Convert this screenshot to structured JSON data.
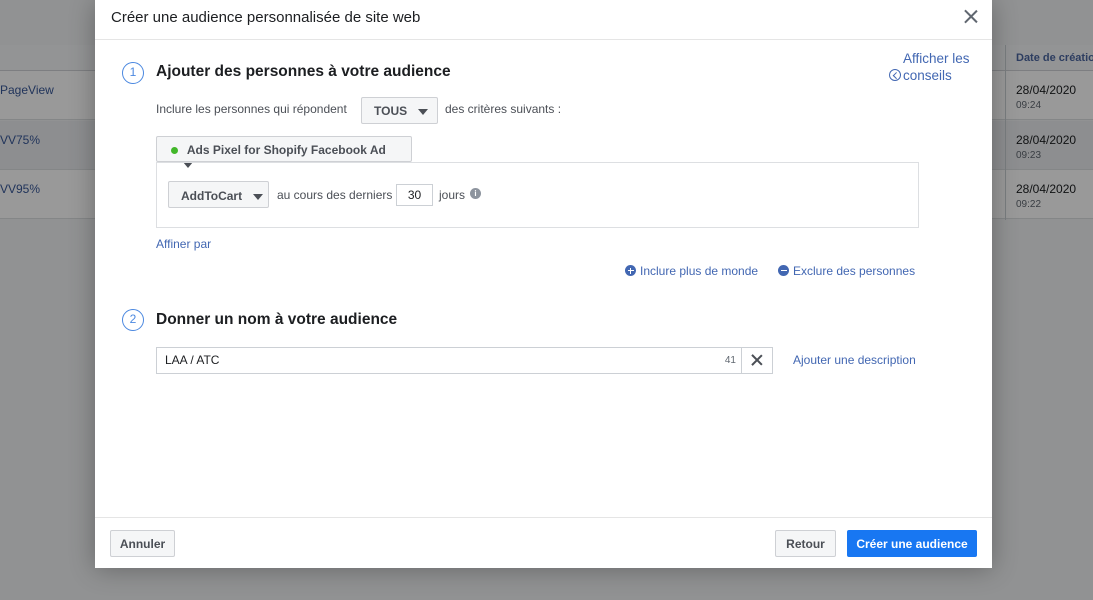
{
  "background": {
    "column_header": "Date de création",
    "rows": [
      {
        "name": "PageView",
        "date": "28/04/2020",
        "time": "09:24"
      },
      {
        "name": "VV75%",
        "date": "28/04/2020",
        "time": "09:23"
      },
      {
        "name": "VV95%",
        "date": "28/04/2020",
        "time": "09:22"
      }
    ]
  },
  "modal": {
    "title": "Créer une audience personnalisée de site web",
    "tips_line1": "Afficher les",
    "tips_line2": "conseils",
    "step1": {
      "number": "1",
      "title": "Ajouter des personnes à votre audience",
      "include_prefix": "Inclure les personnes qui répondent",
      "match_value": "TOUS",
      "include_suffix": "des critères suivants :",
      "pixel_label": "Ads Pixel for Shopify Facebook Ad",
      "event_value": "AddToCart",
      "during_label": "au cours des derniers",
      "days_value": "30",
      "days_unit": "jours",
      "refine_link": "Affiner par",
      "include_more_link": "Inclure plus de monde",
      "exclude_link": "Exclure des personnes"
    },
    "step2": {
      "number": "2",
      "title": "Donner un nom à votre audience",
      "name_value": "LAA / ATC",
      "char_count": "41",
      "add_description_link": "Ajouter une description"
    },
    "footer": {
      "cancel": "Annuler",
      "back": "Retour",
      "create": "Créer une audience"
    }
  },
  "colors": {
    "accent": "#1877f2",
    "link": "#4267b2",
    "pixel_status": "#42b72a"
  }
}
